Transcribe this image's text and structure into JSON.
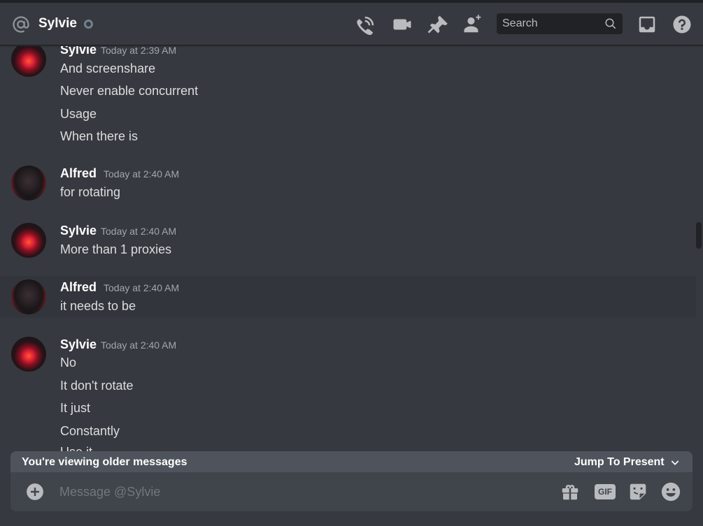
{
  "header": {
    "title": "Sylvie",
    "search_placeholder": "Search",
    "icons": [
      "at-icon",
      "phone-call-icon",
      "video-call-icon",
      "pin-icon",
      "add-friend-icon",
      "search-icon",
      "inbox-icon",
      "help-icon"
    ]
  },
  "colors": {
    "background": "#36393f",
    "header_divider": "#202225",
    "search_bg": "#202225",
    "composer_bg": "#40444b",
    "older_bar_bg": "#4f545c",
    "icon": "#b9bbbe",
    "status_offline": "#747f8d"
  },
  "messages": [
    {
      "author": "Sylvie",
      "time": "Today at 2:39 AM",
      "lines": [
        "And screenshare",
        "Never enable concurrent",
        "Usage",
        "When there is"
      ]
    },
    {
      "author": "Alfred",
      "time": "Today at 2:40 AM",
      "lines": [
        "for rotating"
      ]
    },
    {
      "author": "Sylvie",
      "time": "Today at 2:40 AM",
      "lines": [
        "More than 1 proxies"
      ]
    },
    {
      "author": "Alfred",
      "time": "Today at 2:40 AM",
      "lines": [
        "it needs to be"
      ]
    },
    {
      "author": "Sylvie",
      "time": "Today at 2:40 AM",
      "lines": [
        "No",
        "It don't rotate",
        "It just",
        "Constantly",
        "Use it"
      ]
    }
  ],
  "older_bar": {
    "text": "You're viewing older messages",
    "jump_label": "Jump To Present"
  },
  "composer": {
    "placeholder": "Message @Sylvie",
    "gif_label": "GIF",
    "icons": [
      "plus-circle-icon",
      "gift-icon",
      "gif-icon",
      "sticker-icon",
      "emoji-icon"
    ]
  }
}
